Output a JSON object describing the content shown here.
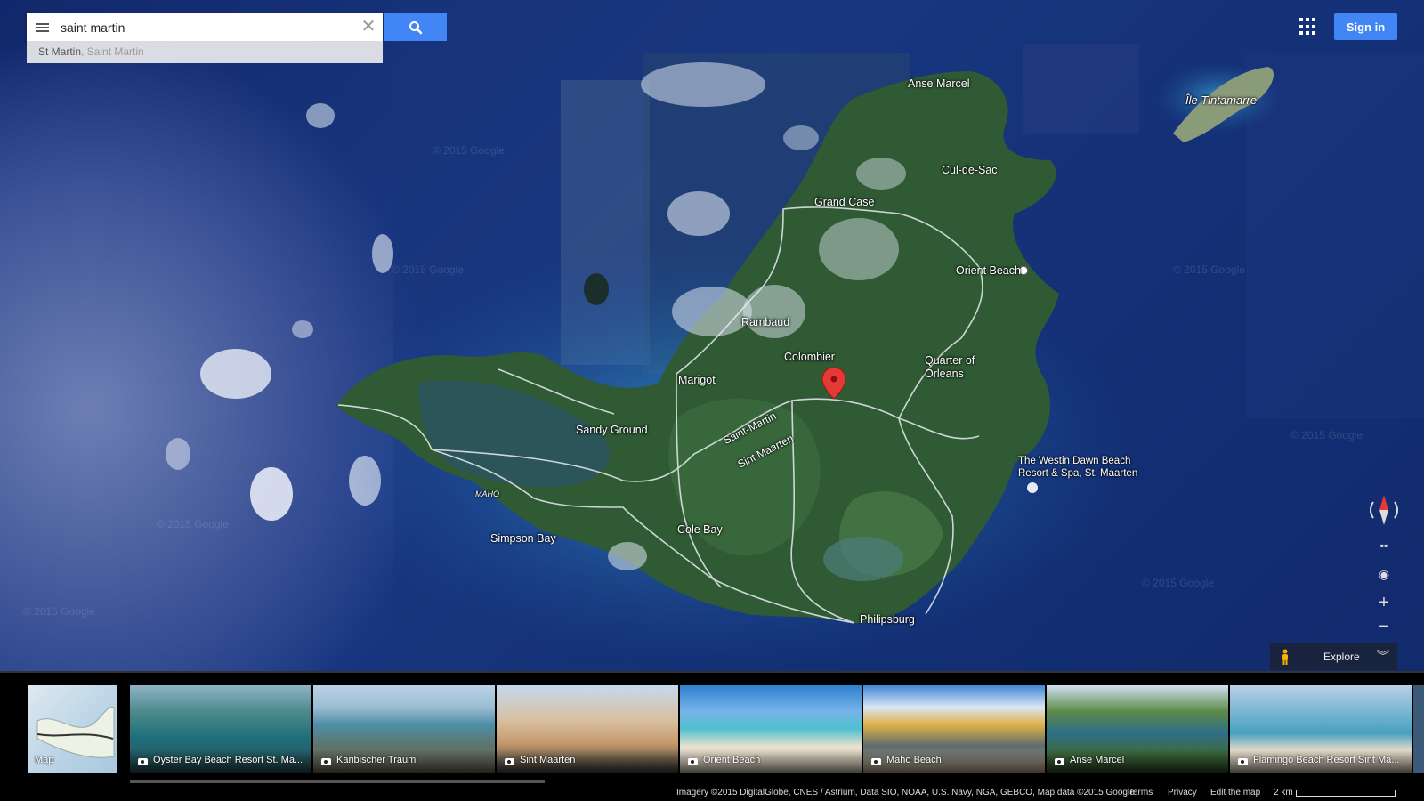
{
  "search": {
    "query": "saint martin",
    "suggestion_main": "St Martin",
    "suggestion_sub": ", Saint Martin"
  },
  "top_right": {
    "sign_in": "Sign in"
  },
  "map": {
    "view": "satellite",
    "labels": {
      "anse_marcel": "Anse Marcel",
      "ile_tintamarre": "Île Tintamarre",
      "cul_de_sac": "Cul-de-Sac",
      "grand_case": "Grand Case",
      "orient_beach": "Orient Beach",
      "rambaud": "Rambaud",
      "colombier": "Colombier",
      "quarter_of_orleans": "Quarter of Orleans",
      "marigot": "Marigot",
      "sandy_ground": "Sandy Ground",
      "saint_martin": "Saint-Martin",
      "sint_maarten": "Sint Maarten",
      "westin": "The Westin Dawn Beach Resort & Spa, St. Maarten",
      "maho": "MAHO",
      "simpson_bay": "Simpson Bay",
      "cole_bay": "Cole Bay",
      "philipsburg": "Philipsburg"
    },
    "watermark": "© 2015 Google",
    "colors": {
      "pin": "#e53935",
      "water_light": "#2a7fb0",
      "land": "#2f5a34"
    }
  },
  "controls": {
    "explore": "Explore"
  },
  "filmstrip": {
    "items": [
      {
        "label": "Map",
        "type": "map"
      },
      {
        "label": "Oyster Bay Beach Resort St. Ma...",
        "type": "photo"
      },
      {
        "label": "Karibischer Traum",
        "type": "photo"
      },
      {
        "label": "Sint Maarten",
        "type": "photo"
      },
      {
        "label": "Orient Beach",
        "type": "photo"
      },
      {
        "label": "Maho Beach",
        "type": "photo"
      },
      {
        "label": "Anse Marcel",
        "type": "photo"
      },
      {
        "label": "Flamingo Beach Resort Sint Ma...",
        "type": "photo"
      }
    ]
  },
  "footer": {
    "imagery": "Imagery ©2015 DigitalGlobe, CNES / Astrium, Data SIO, NOAA, U.S. Navy, NGA, GEBCO, Map data ©2015 Google",
    "terms": "Terms",
    "privacy": "Privacy",
    "edit_map": "Edit the map",
    "scale": "2 km"
  },
  "accent": "#4285f4"
}
